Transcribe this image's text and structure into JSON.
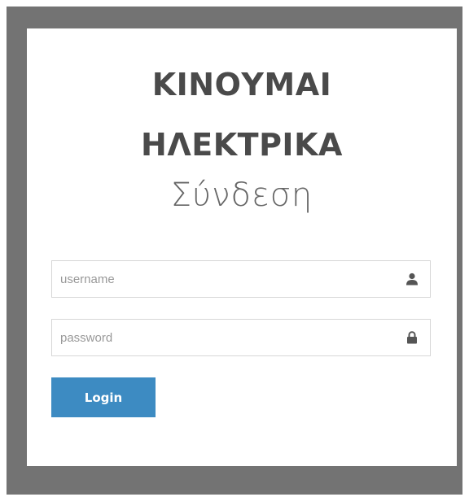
{
  "brand": {
    "line1": "ΚΙΝΟΥΜΑΙ",
    "line2": "ΗΛΕΚΤΡΙΚΑ"
  },
  "form": {
    "title": "Σύνδεση",
    "username": {
      "value": "",
      "placeholder": "username",
      "icon": "user-icon"
    },
    "password": {
      "value": "",
      "placeholder": "password",
      "icon": "lock-icon"
    },
    "login_label": "Login"
  },
  "colors": {
    "frame": "#737373",
    "card": "#ffffff",
    "brand_text": "#4a4a4a",
    "button": "#3d8bc2",
    "button_text": "#ffffff"
  }
}
